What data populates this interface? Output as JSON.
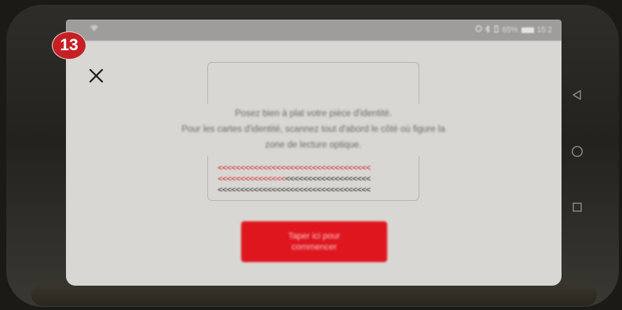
{
  "status_bar": {
    "battery": "65%",
    "time": "15:2"
  },
  "dialog": {
    "instruction_lines": [
      "Posez bien à plat votre pièce d'identité.",
      "Pour les cartes d'identité, scannez tout d'abord le côté où figure la",
      "zone de lecture optique."
    ],
    "mrz_lines": [
      "<<<<<<<<<<<<<<<<<<<<<<<<<<<<<<<<<<",
      "<<<<<<<<<<<<<<<<<<<<<<<<<<<<<<<<<<",
      "<<<<<<<<<<<<<<<<<<<<<<<<<<<<<<<<<<"
    ],
    "start_button_label": "Taper ici pour commencer"
  },
  "annotation_badge": "13",
  "icons": {
    "close": "close-icon",
    "back": "back-triangle-icon",
    "home": "home-circle-icon",
    "recents": "recents-square-icon",
    "wifi": "wifi-icon",
    "alarm": "alarm-icon",
    "bluetooth": "bluetooth-icon",
    "vibrate": "vibrate-icon",
    "battery": "battery-icon"
  },
  "colors": {
    "accent": "#e0161e",
    "mrz_red": "#d8343b",
    "mrz_dark": "#3a3936",
    "screen_bg": "#d9d7d3"
  }
}
